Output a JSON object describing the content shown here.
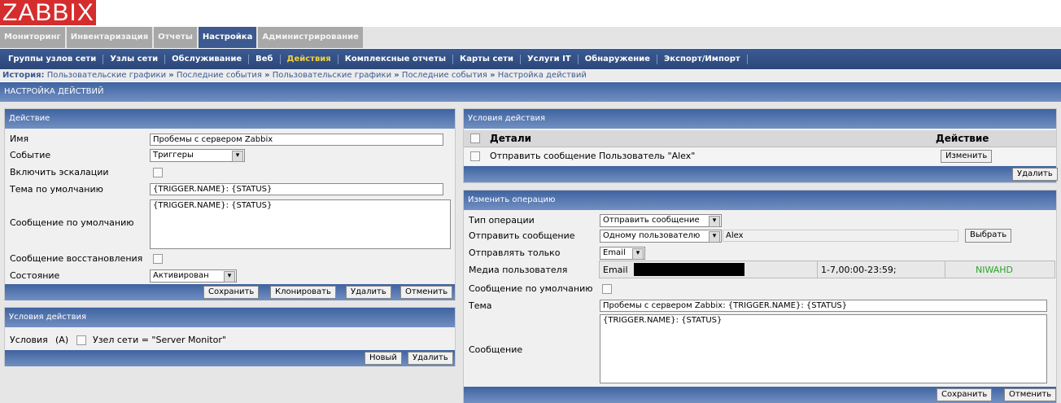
{
  "logo": "ZABBIX",
  "tabs": [
    "Мониторинг",
    "Инвентаризация",
    "Отчеты",
    "Настройка",
    "Администрирование"
  ],
  "submenu": [
    "Группы узлов сети",
    "Узлы сети",
    "Обслуживание",
    "Веб",
    "Действия",
    "Комплексные отчеты",
    "Карты сети",
    "Услуги IT",
    "Обнаружение",
    "Экспорт/Импорт"
  ],
  "breadcrumb": {
    "label": "История:",
    "items": [
      "Пользовательские графики",
      "Последние события",
      "Пользовательские графики",
      "Последние события",
      "Настройка действий"
    ],
    "sep": "»"
  },
  "page_title": "НАСТРОЙКА ДЕЙСТВИЙ",
  "action": {
    "title": "Действие",
    "name_label": "Имя",
    "name_value": "Пробемы с сервером Zabbix",
    "event_label": "Событие",
    "event_value": "Триггеры",
    "escalation_label": "Включить эскалации",
    "subject_label": "Тема по умолчанию",
    "subject_value": "{TRIGGER.NAME}: {STATUS}",
    "message_label": "Сообщение по умолчанию",
    "message_value": "{TRIGGER.NAME}: {STATUS}",
    "recovery_label": "Сообщение восстановления",
    "status_label": "Состояние",
    "status_value": "Активирован",
    "buttons": [
      "Сохранить",
      "Клонировать",
      "Удалить",
      "Отменить"
    ]
  },
  "conditions": {
    "title": "Условия действия",
    "label": "Условия",
    "tag": "(A)",
    "condition": "Узел сети = \"Server Monitor\"",
    "buttons": [
      "Новый",
      "Удалить"
    ]
  },
  "operations": {
    "title": "Условия действия",
    "col_details": "Детали",
    "col_action": "Действие",
    "row_text": "Отправить сообщение Пользователь \"Alex\"",
    "edit_button": "Изменить",
    "delete_button": "Удалить"
  },
  "edit_op": {
    "title": "Изменить операцию",
    "type_label": "Тип операции",
    "type_value": "Отправить сообщение",
    "send_label": "Отправить сообщение",
    "send_value": "Одному пользователю",
    "user_value": "Alex",
    "select_button": "Выбрать",
    "only_label": "Отправлять только",
    "only_value": "Email",
    "media_label": "Медиа пользователя",
    "media_type": "Email",
    "media_period": "1-7,00:00-23:59;",
    "media_severity": "NIWAHD",
    "default_label": "Сообщение по умолчанию",
    "subject_label": "Тема",
    "subject_value": "Пробемы с сервером Zabbix: {TRIGGER.NAME}: {STATUS}",
    "message_label": "Сообщение",
    "message_value": "{TRIGGER.NAME}: {STATUS}",
    "buttons": [
      "Сохранить",
      "Отменить"
    ]
  },
  "colors": {
    "accent": "#3b5b93",
    "logo": "#d52d2d",
    "active_menu": "#f1d23a",
    "severity": "#2aa52a"
  }
}
